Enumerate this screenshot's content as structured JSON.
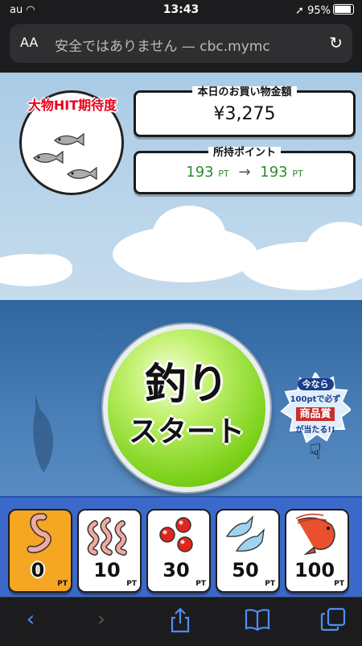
{
  "status_bar": {
    "carrier": "au",
    "time": "13:43",
    "battery": "95%"
  },
  "browser": {
    "text_size_label": "AA",
    "address_text": "安全ではありません — cbc.mymc"
  },
  "game": {
    "hit_badge": {
      "title": "大物HIT期待度"
    },
    "purchase": {
      "label": "本日のお買い物金額",
      "amount": "¥3,275"
    },
    "points": {
      "label": "所持ポイント",
      "from": "193",
      "arrow": "→",
      "to": "193",
      "unit": "PT"
    },
    "start_button": {
      "line1": "釣り",
      "line2": "スタート"
    },
    "promo": {
      "line1": "今なら",
      "line2": "100ptで必ず",
      "line3": "商品賞",
      "line4": "が当たる!!"
    },
    "baits": [
      {
        "value": "0",
        "unit": "PT",
        "icon": "worm-single-icon",
        "selected": true
      },
      {
        "value": "10",
        "unit": "PT",
        "icon": "worms-icon",
        "selected": false
      },
      {
        "value": "30",
        "unit": "PT",
        "icon": "red-balls-icon",
        "selected": false
      },
      {
        "value": "50",
        "unit": "PT",
        "icon": "small-fish-icon",
        "selected": false
      },
      {
        "value": "100",
        "unit": "PT",
        "icon": "shrimp-icon",
        "selected": false
      }
    ]
  },
  "colors": {
    "accent_green": "#7dd21c",
    "tray_blue": "#3b69c9",
    "selected_orange": "#f5a623",
    "hit_red": "#e8001c"
  }
}
